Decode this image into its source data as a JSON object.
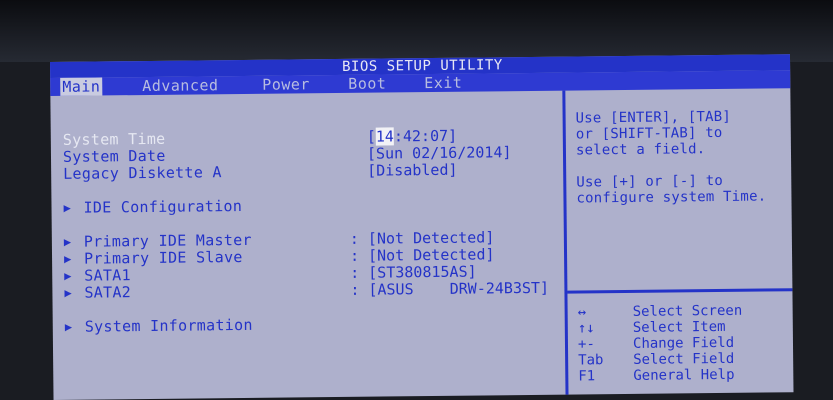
{
  "title": "BIOS SETUP UTILITY",
  "menu": [
    "Main",
    "Advanced",
    "Power",
    "Boot",
    "Exit"
  ],
  "items": {
    "system_time": {
      "label": "System Time",
      "value_cursor": "14",
      "value_rest": ":42:07]"
    },
    "system_date": {
      "label": "System Date",
      "value": "[Sun 02/16/2014]"
    },
    "legacy_diskette": {
      "label": "Legacy Diskette A",
      "value": "[Disabled]"
    },
    "ide_config": {
      "label": "IDE Configuration"
    },
    "primary_ide_master": {
      "label": "Primary IDE Master",
      "value": "[Not Detected]"
    },
    "primary_ide_slave": {
      "label": "Primary IDE Slave",
      "value": "[Not Detected]"
    },
    "sata1": {
      "label": "SATA1",
      "value": "[ST380815AS]"
    },
    "sata2": {
      "label": "SATA2",
      "value": "[ASUS    DRW-24B3ST]"
    },
    "system_info": {
      "label": "System Information"
    }
  },
  "colon": ":",
  "bracket_open": "[",
  "arrow_glyph": "▶",
  "help": {
    "line1": "Use [ENTER], [TAB]",
    "line2": "or [SHIFT-TAB] to",
    "line3": "select a field.",
    "line4": "Use [+] or [-] to",
    "line5": "configure system Time."
  },
  "keys": [
    {
      "key": "↔",
      "desc": "Select Screen"
    },
    {
      "key": "↑↓",
      "desc": "Select Item"
    },
    {
      "key": "+-",
      "desc": "Change Field"
    },
    {
      "key": "Tab",
      "desc": "Select Field"
    },
    {
      "key": "F1",
      "desc": "General Help"
    }
  ],
  "colors": {
    "bios_blue": "#2433c8",
    "panel_gray": "#aeb0cc",
    "highlight_white": "#e6e8f2"
  }
}
